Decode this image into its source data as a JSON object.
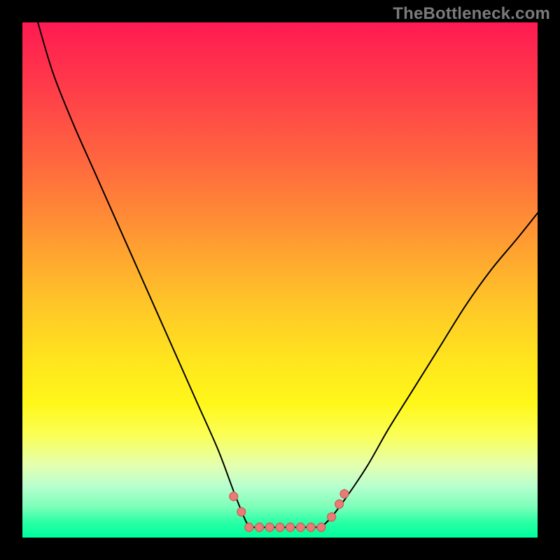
{
  "watermark": "TheBottleneck.com",
  "colors": {
    "page_bg": "#000000",
    "gradient_top": "#ff1a52",
    "gradient_mid": "#ffe61e",
    "gradient_bottom": "#00ff9c",
    "curve_stroke": "#000000",
    "marker_fill": "#e77c77",
    "marker_stroke": "#d15a55"
  },
  "chart_data": {
    "type": "line",
    "title": "",
    "xlabel": "",
    "ylabel": "",
    "xlim": [
      0,
      100
    ],
    "ylim": [
      0,
      100
    ],
    "grid": false,
    "legend": false,
    "left_curve": {
      "x": [
        3,
        6,
        10,
        14,
        18,
        22,
        26,
        30,
        34,
        38,
        41,
        43,
        44
      ],
      "y": [
        100,
        90,
        80,
        71,
        62,
        53,
        44,
        35,
        26,
        17,
        9,
        4,
        2
      ]
    },
    "floor": {
      "x": [
        44,
        58
      ],
      "y": [
        2,
        2
      ]
    },
    "right_curve": {
      "x": [
        58,
        60,
        63,
        67,
        71,
        76,
        81,
        86,
        91,
        96,
        100
      ],
      "y": [
        2,
        4,
        8,
        14,
        21,
        29,
        37,
        45,
        52,
        58,
        63
      ]
    },
    "markers": [
      {
        "x": 41,
        "y": 8
      },
      {
        "x": 42.5,
        "y": 5
      },
      {
        "x": 44,
        "y": 2
      },
      {
        "x": 46,
        "y": 2
      },
      {
        "x": 48,
        "y": 2
      },
      {
        "x": 50,
        "y": 2
      },
      {
        "x": 52,
        "y": 2
      },
      {
        "x": 54,
        "y": 2
      },
      {
        "x": 56,
        "y": 2
      },
      {
        "x": 58,
        "y": 2
      },
      {
        "x": 60,
        "y": 4
      },
      {
        "x": 61.5,
        "y": 6.5
      },
      {
        "x": 62.5,
        "y": 8.5
      }
    ]
  }
}
